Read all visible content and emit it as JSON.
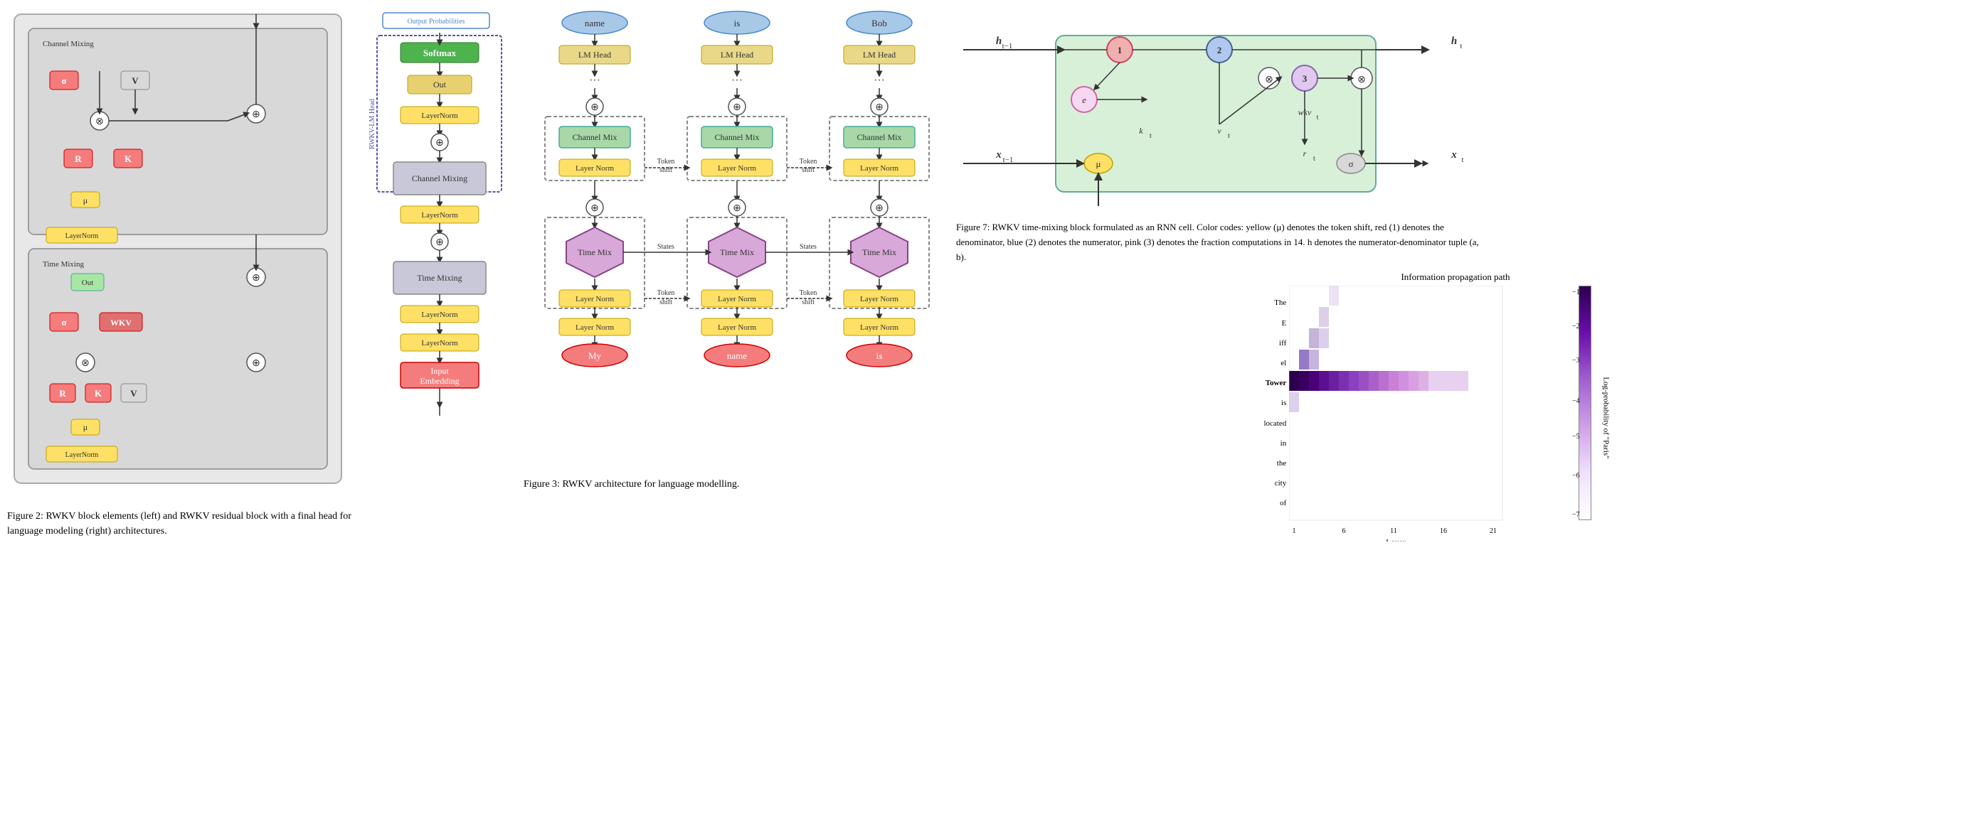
{
  "fig2": {
    "caption": "Figure 2: RWKV block elements (left) and RWKV residual block with a final head for language modeling (right) architectures.",
    "channel_mixing_label": "Channel Mixing",
    "time_mixing_label": "Time Mixing",
    "sigma_label": "σ",
    "r_label": "R",
    "k_label": "K",
    "v_label": "V",
    "mu_label": "μ",
    "layernorm_label": "LayerNorm",
    "out_label": "Out",
    "wkv_label": "WKV",
    "plus_symbol": "⊕",
    "times_symbol": "⊗"
  },
  "fig3_lm": {
    "output_prob_label": "Output Probabilities",
    "rwkv_lm_label": "RWKV-LM Head",
    "softmax_label": "Softmax",
    "out_label": "Out",
    "layernorm_label": "LayerNorm",
    "channel_mixing_label": "Channel Mixing",
    "time_mixing_label": "Time Mixing",
    "input_embedding_label": "Input Embedding",
    "plus_symbol": "⊕"
  },
  "fig3_arch": {
    "caption": "Figure 3: RWKV architecture for language modelling.",
    "columns": [
      {
        "output_word": "name",
        "lm_head": "LM Head",
        "dots": "...",
        "channel_mix": "Channel Mix",
        "layer_norm1": "Layer Norm",
        "plus1": "⊕",
        "time_mix": "Time Mix",
        "layer_norm2": "Layer Norm",
        "layer_norm3": "Layer Norm",
        "input_word": "My"
      },
      {
        "output_word": "is",
        "lm_head": "LM Head",
        "dots": "...",
        "channel_mix": "Channel Mix",
        "layer_norm1": "Layer Norm",
        "plus1": "⊕",
        "time_mix": "Time Mix",
        "layer_norm2": "Layer Norm",
        "layer_norm3": "Layer Norm",
        "input_word": "name"
      },
      {
        "output_word": "Bob",
        "lm_head": "LM Head",
        "dots": "...",
        "channel_mix": "Channel Mix",
        "layer_norm1": "Layer Norm",
        "plus1": "⊕",
        "time_mix": "Time Mix",
        "layer_norm2": "Layer Norm",
        "layer_norm3": "Layer Norm",
        "input_word": "is"
      }
    ],
    "token_shift_label": "Token shift",
    "states_label": "States"
  },
  "fig7": {
    "caption": "Figure 7: RWKV time-mixing block formulated as an RNN cell. Color codes: yellow (μ) denotes the token shift, red (1) denotes the denominator, blue (2) denotes the numerator, pink (3) denotes the fraction computations in 14. h denotes the numerator-denominator tuple (a, b).",
    "h_prev": "h_{t-1}",
    "h_next": "h_t",
    "x_prev": "x_{t-1}",
    "x_next": "x_t",
    "x_t": "x_t",
    "k_t": "k_t",
    "v_t": "v_t",
    "r_t": "r_t",
    "wkv_t": "wkv_t",
    "mu_label": "μ",
    "sigma_label": "σ",
    "e_label": "e",
    "n1_label": "1",
    "n2_label": "2",
    "n3_label": "3"
  },
  "heatmap": {
    "title": "Information propagation path",
    "xlabel": "Layer",
    "ylabel": "Log-probability of \"Paris\"",
    "yticks": [
      "The",
      "E",
      "iff",
      "el",
      "Tower",
      "is",
      "located",
      "in",
      "the",
      "city",
      "of"
    ],
    "xticks": [
      "1",
      "6",
      "11",
      "16",
      "21"
    ],
    "colorbar_labels": [
      "-1",
      "-2",
      "-3",
      "-4",
      "-5",
      "-6",
      "-7"
    ]
  }
}
